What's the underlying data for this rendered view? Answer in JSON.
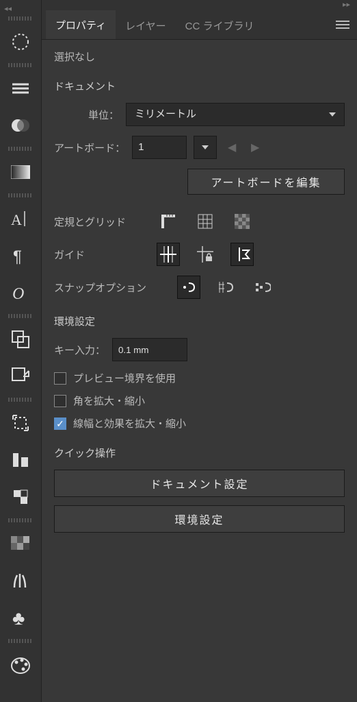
{
  "tabs": {
    "properties": "プロパティ",
    "layers": "レイヤー",
    "cclib": "CC ライブラリ"
  },
  "selection_none": "選択なし",
  "document": {
    "title": "ドキュメント",
    "units_label": "単位：",
    "units_value": "ミリメートル",
    "artboard_label": "アートボード：",
    "artboard_value": "1",
    "edit_artboard_btn": "アートボードを編集"
  },
  "rulers_grid_label": "定規とグリッド",
  "guides_label": "ガイド",
  "snap_label": "スナップオプション",
  "prefs": {
    "title": "環境設定",
    "key_input_label": "キー入力：",
    "key_input_value": "0.1 mm",
    "cb_preview": "プレビュー境界を使用",
    "cb_scale_corners": "角を拡大・縮小",
    "cb_scale_strokes": "線幅と効果を拡大・縮小"
  },
  "quick": {
    "title": "クイック操作",
    "btn_doc_setup": "ドキュメント設定",
    "btn_prefs": "環境設定"
  }
}
